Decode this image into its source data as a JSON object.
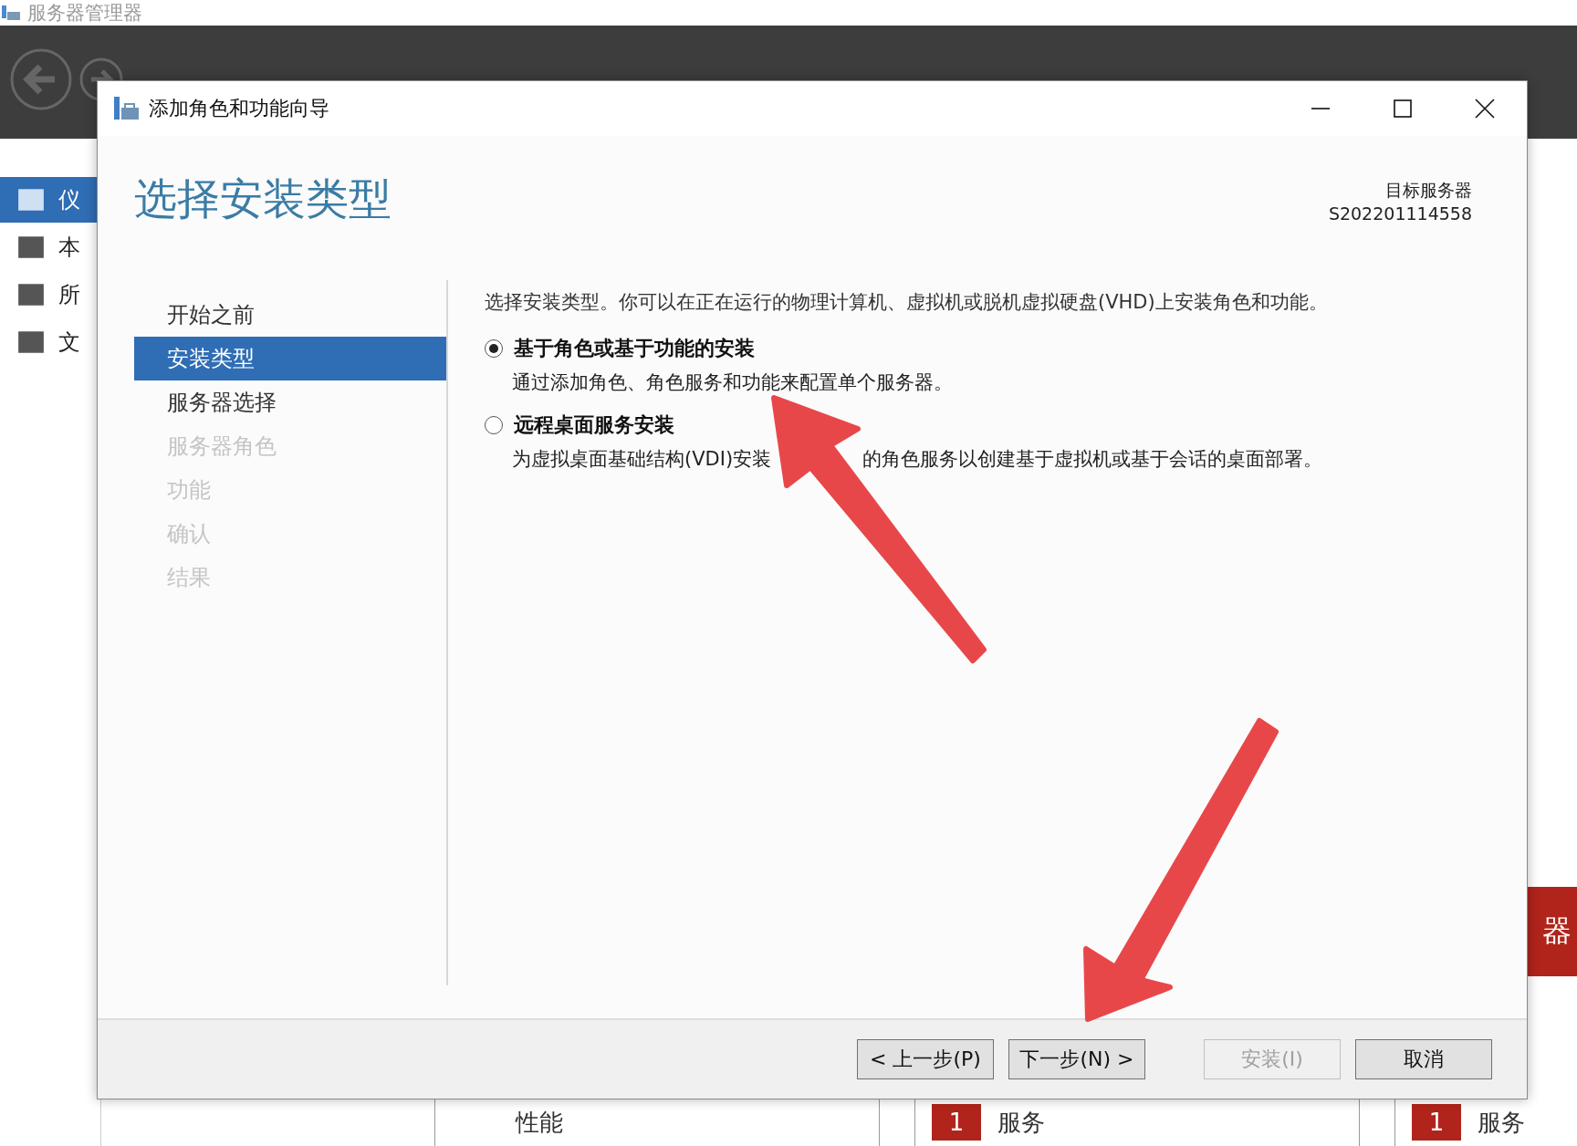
{
  "app": {
    "title": "服务器管理器",
    "sidebar": [
      {
        "label": "仪",
        "selected": true
      },
      {
        "label": "本",
        "selected": false
      },
      {
        "label": "所",
        "selected": false
      },
      {
        "label": "文",
        "selected": false
      }
    ],
    "red_tile": "器",
    "tiles": [
      {
        "label": "性能"
      },
      {
        "count": "1",
        "label": "服务"
      },
      {
        "count": "1",
        "label": "服务"
      }
    ]
  },
  "dialog": {
    "title": "添加角色和功能向导",
    "heading": "选择安装类型",
    "target_label": "目标服务器",
    "target_server": "S202201114558",
    "steps": [
      {
        "label": "开始之前",
        "selected": false,
        "disabled": false
      },
      {
        "label": "安装类型",
        "selected": true,
        "disabled": false
      },
      {
        "label": "服务器选择",
        "selected": false,
        "disabled": false
      },
      {
        "label": "服务器角色",
        "selected": false,
        "disabled": true
      },
      {
        "label": "功能",
        "selected": false,
        "disabled": true
      },
      {
        "label": "确认",
        "selected": false,
        "disabled": true
      },
      {
        "label": "结果",
        "selected": false,
        "disabled": true
      }
    ],
    "intro": "选择安装类型。你可以在正在运行的物理计算机、虚拟机或脱机虚拟硬盘(VHD)上安装角色和功能。",
    "options": [
      {
        "label": "基于角色或基于功能的安装",
        "description": [
          "通过添加角色、角色服务和功能来配置单个服务器。"
        ],
        "selected": true
      },
      {
        "label": "远程桌面服务安装",
        "description": [
          "为虚拟桌面基础结构(VDI)安装",
          "的角色服务以创建基于虚拟机或基于会话的桌面部署。"
        ],
        "selected": false
      }
    ],
    "buttons": [
      {
        "label": "< 上一步(P)",
        "disabled": false
      },
      {
        "label": "下一步(N) >",
        "disabled": false
      },
      {
        "label": "安装(I)",
        "disabled": true
      },
      {
        "label": "取消",
        "disabled": false
      }
    ]
  }
}
